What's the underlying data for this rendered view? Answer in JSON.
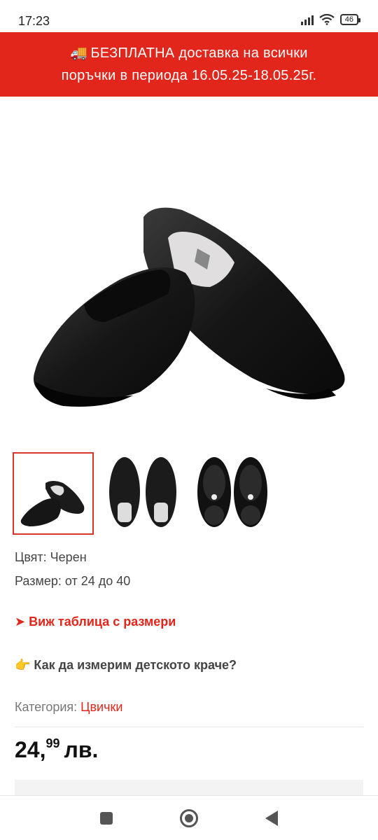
{
  "status_bar": {
    "time": "17:23",
    "battery": "46"
  },
  "promo": {
    "line1": "БЕЗПЛАТНА доставка на всички",
    "line2": "поръчки в периода 16.05.25-18.05.25г.",
    "icon": "truck-icon"
  },
  "product": {
    "color_label": "Цвят: Черен",
    "size_label": "Размер: от 24 до 40",
    "size_table_link": "➤ Виж таблица с размери",
    "measure_link": "👉 Как да измерим детското краче?",
    "category_label": "Категория:",
    "category_value": "Цвички",
    "price_main": "24,",
    "price_cents": "99",
    "price_currency": "лв."
  },
  "colors": {
    "accent": "#e2261b",
    "shoe": "#1b1b1b"
  }
}
